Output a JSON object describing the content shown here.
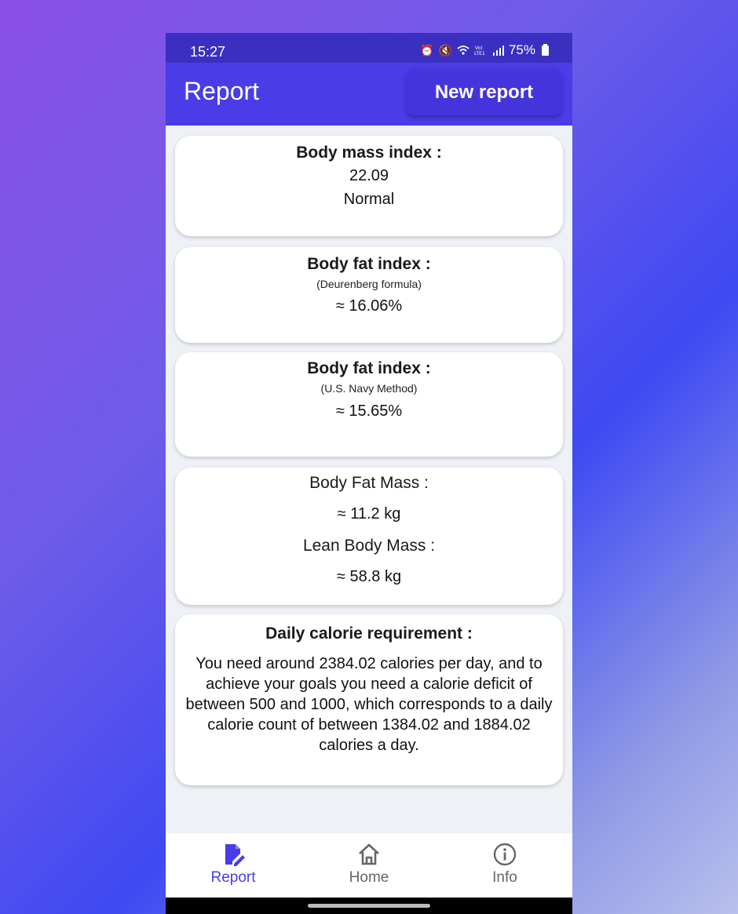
{
  "status": {
    "time": "15:27",
    "battery": "75%",
    "icons": [
      "alarm-icon",
      "mute-icon",
      "wifi-icon",
      "volte-icon",
      "signal-icon",
      "battery-icon"
    ]
  },
  "appbar": {
    "title": "Report",
    "new_report_label": "New report"
  },
  "bmi": {
    "heading": "Body mass index :",
    "value": "22.09",
    "category": "Normal"
  },
  "fat_deurenberg": {
    "heading": "Body fat index :",
    "method": "(Deurenberg formula)",
    "value": "≈ 16.06%"
  },
  "fat_navy": {
    "heading": "Body fat index :",
    "method": "(U.S. Navy Method)",
    "value": "≈ 15.65%"
  },
  "mass": {
    "fat_heading": "Body Fat Mass :",
    "fat_value": "≈ 11.2 kg",
    "lean_heading": "Lean Body Mass :",
    "lean_value": "≈ 58.8 kg"
  },
  "calories": {
    "heading": "Daily calorie requirement :",
    "text": "You need around 2384.02 calories per day, and to achieve your goals you need a calorie deficit of between 500 and 1000, which corresponds to a daily calorie count of between 1384.02 and 1884.02 calories a day."
  },
  "nav": {
    "items": [
      {
        "label": "Report",
        "icon": "edit-document-icon",
        "active": true
      },
      {
        "label": "Home",
        "icon": "home-icon",
        "active": false
      },
      {
        "label": "Info",
        "icon": "info-icon",
        "active": false
      }
    ]
  },
  "colors": {
    "accent": "#4a3ce6",
    "statusbar": "#3a2fc1",
    "background": "#eef1f6"
  }
}
